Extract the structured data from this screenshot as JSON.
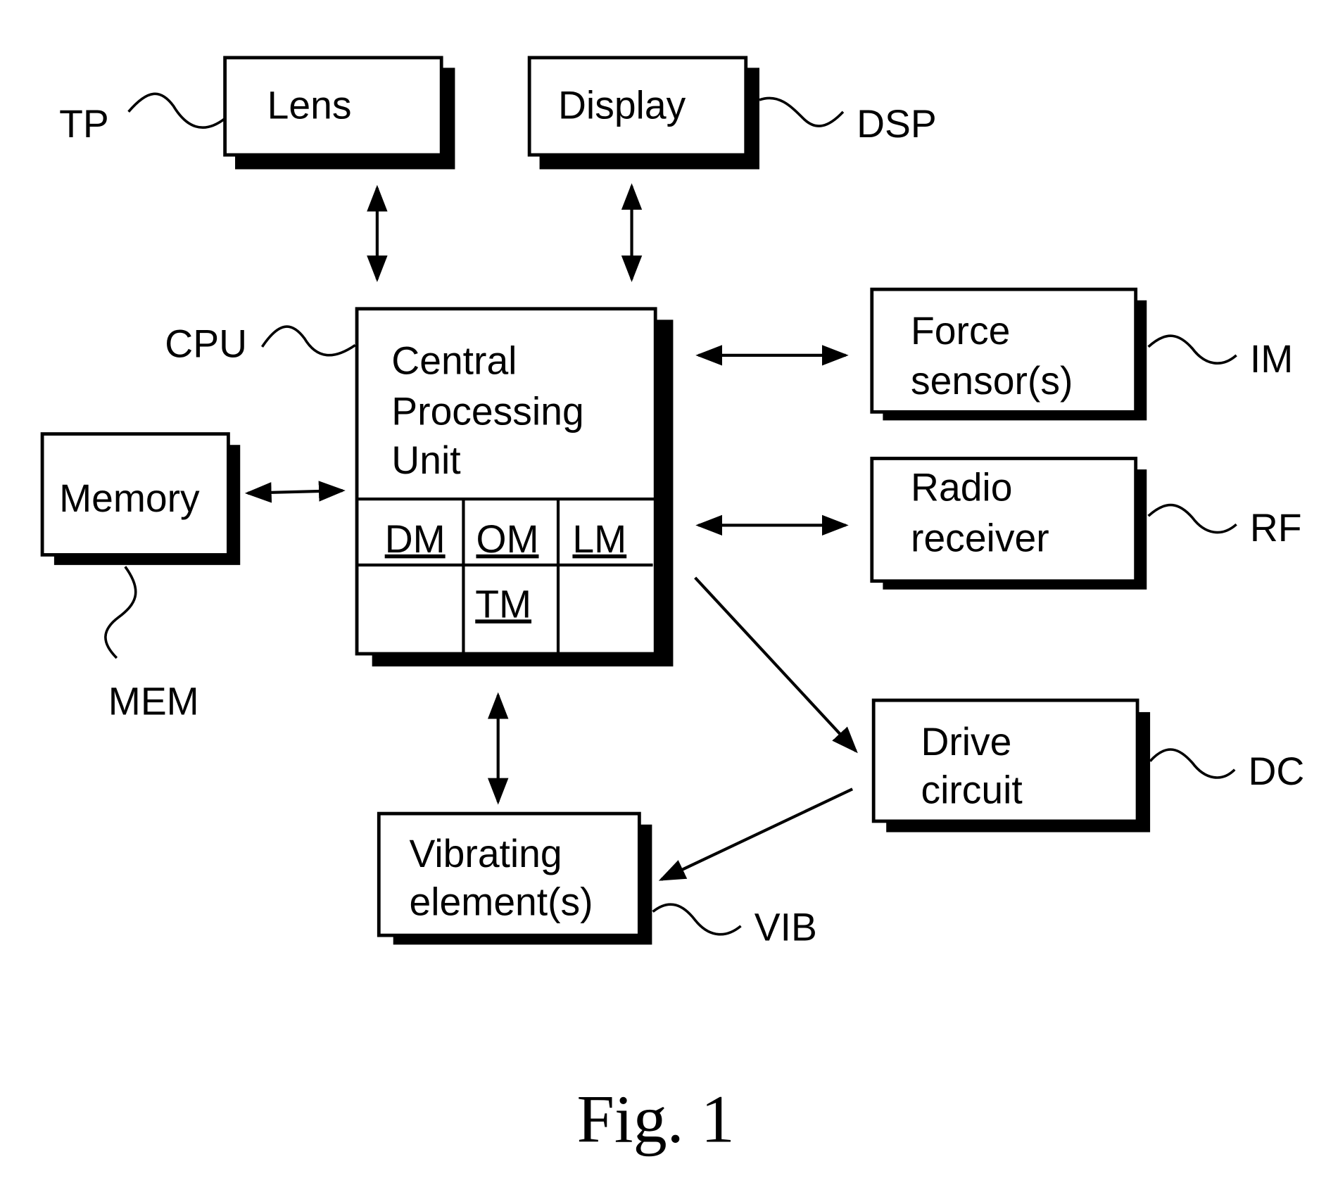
{
  "blocks": {
    "lens": {
      "label": "Lens",
      "ref": "TP"
    },
    "display": {
      "label": "Display",
      "ref": "DSP"
    },
    "cpu": {
      "lines": [
        "Central",
        "Processing",
        "Unit"
      ],
      "ref": "CPU",
      "modules": {
        "dm": "DM",
        "om": "OM",
        "lm": "LM",
        "tm": "TM"
      }
    },
    "memory": {
      "label": "Memory",
      "ref": "MEM"
    },
    "force": {
      "lines": [
        "Force",
        "sensor(s)"
      ],
      "ref": "IM"
    },
    "radio": {
      "lines": [
        "Radio",
        "receiver"
      ],
      "ref": "RF"
    },
    "drive": {
      "lines": [
        "Drive",
        "circuit"
      ],
      "ref": "DC"
    },
    "vib": {
      "lines": [
        "Vibrating",
        "element(s)"
      ],
      "ref": "VIB"
    }
  },
  "caption": "Fig. 1"
}
